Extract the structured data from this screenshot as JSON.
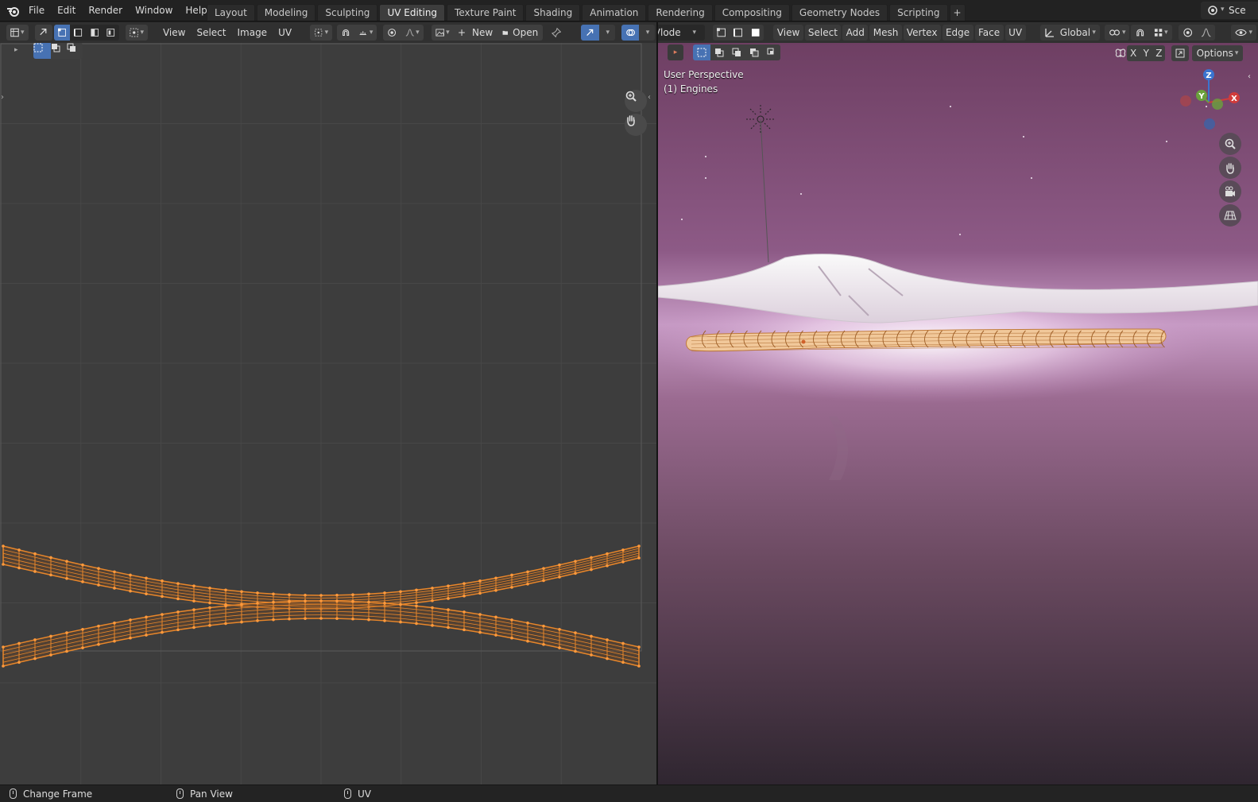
{
  "topbar": {
    "menus": [
      "File",
      "Edit",
      "Render",
      "Window",
      "Help"
    ],
    "workspaces": [
      "Layout",
      "Modeling",
      "Sculpting",
      "UV Editing",
      "Texture Paint",
      "Shading",
      "Animation",
      "Rendering",
      "Compositing",
      "Geometry Nodes",
      "Scripting"
    ],
    "active_workspace": "UV Editing",
    "add_tab": "+",
    "scene_label": "Sce"
  },
  "uv_editor": {
    "menus": [
      "View",
      "Select",
      "Image",
      "UV"
    ],
    "new_label": "New",
    "open_label": "Open"
  },
  "viewport": {
    "mode_label": "UV",
    "mode_label_rest": "lode",
    "menus": [
      "View",
      "Select",
      "Add",
      "Mesh",
      "Vertex",
      "Edge",
      "Face",
      "UV"
    ],
    "transform_orientation": "Global",
    "axis_x": "X",
    "axis_y": "Y",
    "axis_z": "Z",
    "options_label": "Options",
    "view_name": "User Perspective",
    "object_info": "(1) Engines",
    "gizmo_x": "X",
    "gizmo_y": "Y",
    "gizmo_z": "Z"
  },
  "statusbar": {
    "items": [
      "Change Frame",
      "Pan View",
      "UV"
    ]
  },
  "colors": {
    "accent": "#4772b3",
    "uv_orange": "#e8862a",
    "gizmo_x": "#d13b3b",
    "gizmo_y": "#6aa13c",
    "gizmo_z": "#3a74d0"
  }
}
